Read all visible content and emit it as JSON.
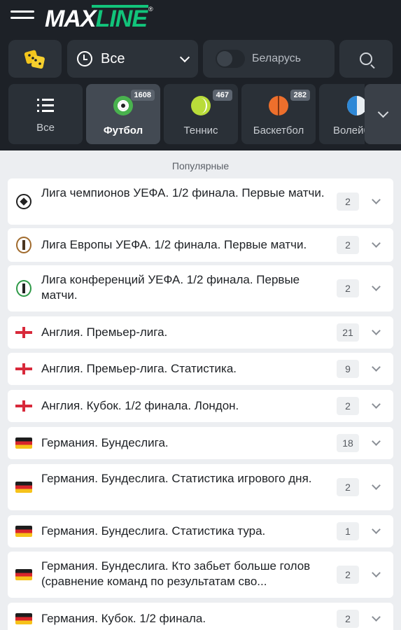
{
  "header": {
    "logo_part1": "MAX",
    "logo_part2": "LINE",
    "logo_mark": "®",
    "filter_label": "Все",
    "region_label": "Беларусь"
  },
  "sports": [
    {
      "label": "Все",
      "count": "",
      "icon": "list-icon"
    },
    {
      "label": "Футбол",
      "count": "1608",
      "icon": "football-icon"
    },
    {
      "label": "Теннис",
      "count": "467",
      "icon": "tennis-icon"
    },
    {
      "label": "Баскетбол",
      "count": "282",
      "icon": "basketball-icon"
    },
    {
      "label": "Волейбол",
      "count": "",
      "icon": "volleyball-icon"
    }
  ],
  "section_title": "Популярные",
  "leagues": [
    {
      "name": "Лига чемпионов УЕФА. 1/2 финала. Первые матчи.",
      "count": "2",
      "icon": "champions-league-icon"
    },
    {
      "name": "Лига Европы УЕФА. 1/2 финала. Первые матчи.",
      "count": "2",
      "icon": "europa-league-icon"
    },
    {
      "name": "Лига конференций УЕФА. 1/2 финала. Первые матчи.",
      "count": "2",
      "icon": "conference-league-icon"
    },
    {
      "name": "Англия. Премьер-лига.",
      "count": "21",
      "icon": "england-flag-icon"
    },
    {
      "name": "Англия. Премьер-лига. Статистика.",
      "count": "9",
      "icon": "england-flag-icon"
    },
    {
      "name": "Англия. Кубок. 1/2 финала. Лондон.",
      "count": "2",
      "icon": "england-flag-icon"
    },
    {
      "name": "Германия. Бундеслига.",
      "count": "18",
      "icon": "germany-flag-icon"
    },
    {
      "name": "Германия. Бундеслига. Статистика игрового дня.",
      "count": "2",
      "icon": "germany-flag-icon"
    },
    {
      "name": "Германия. Бундеслига. Статистика тура.",
      "count": "1",
      "icon": "germany-flag-icon"
    },
    {
      "name": "Германия. Бундеслига. Кто забьет больше голов (сравнение команд по результатам сво...",
      "count": "2",
      "icon": "germany-flag-icon"
    },
    {
      "name": "Германия. Кубок. 1/2 финала.",
      "count": "2",
      "icon": "germany-flag-icon"
    }
  ],
  "colors": {
    "brand_green": "#12c47b",
    "header_bg": "#1d2127"
  }
}
